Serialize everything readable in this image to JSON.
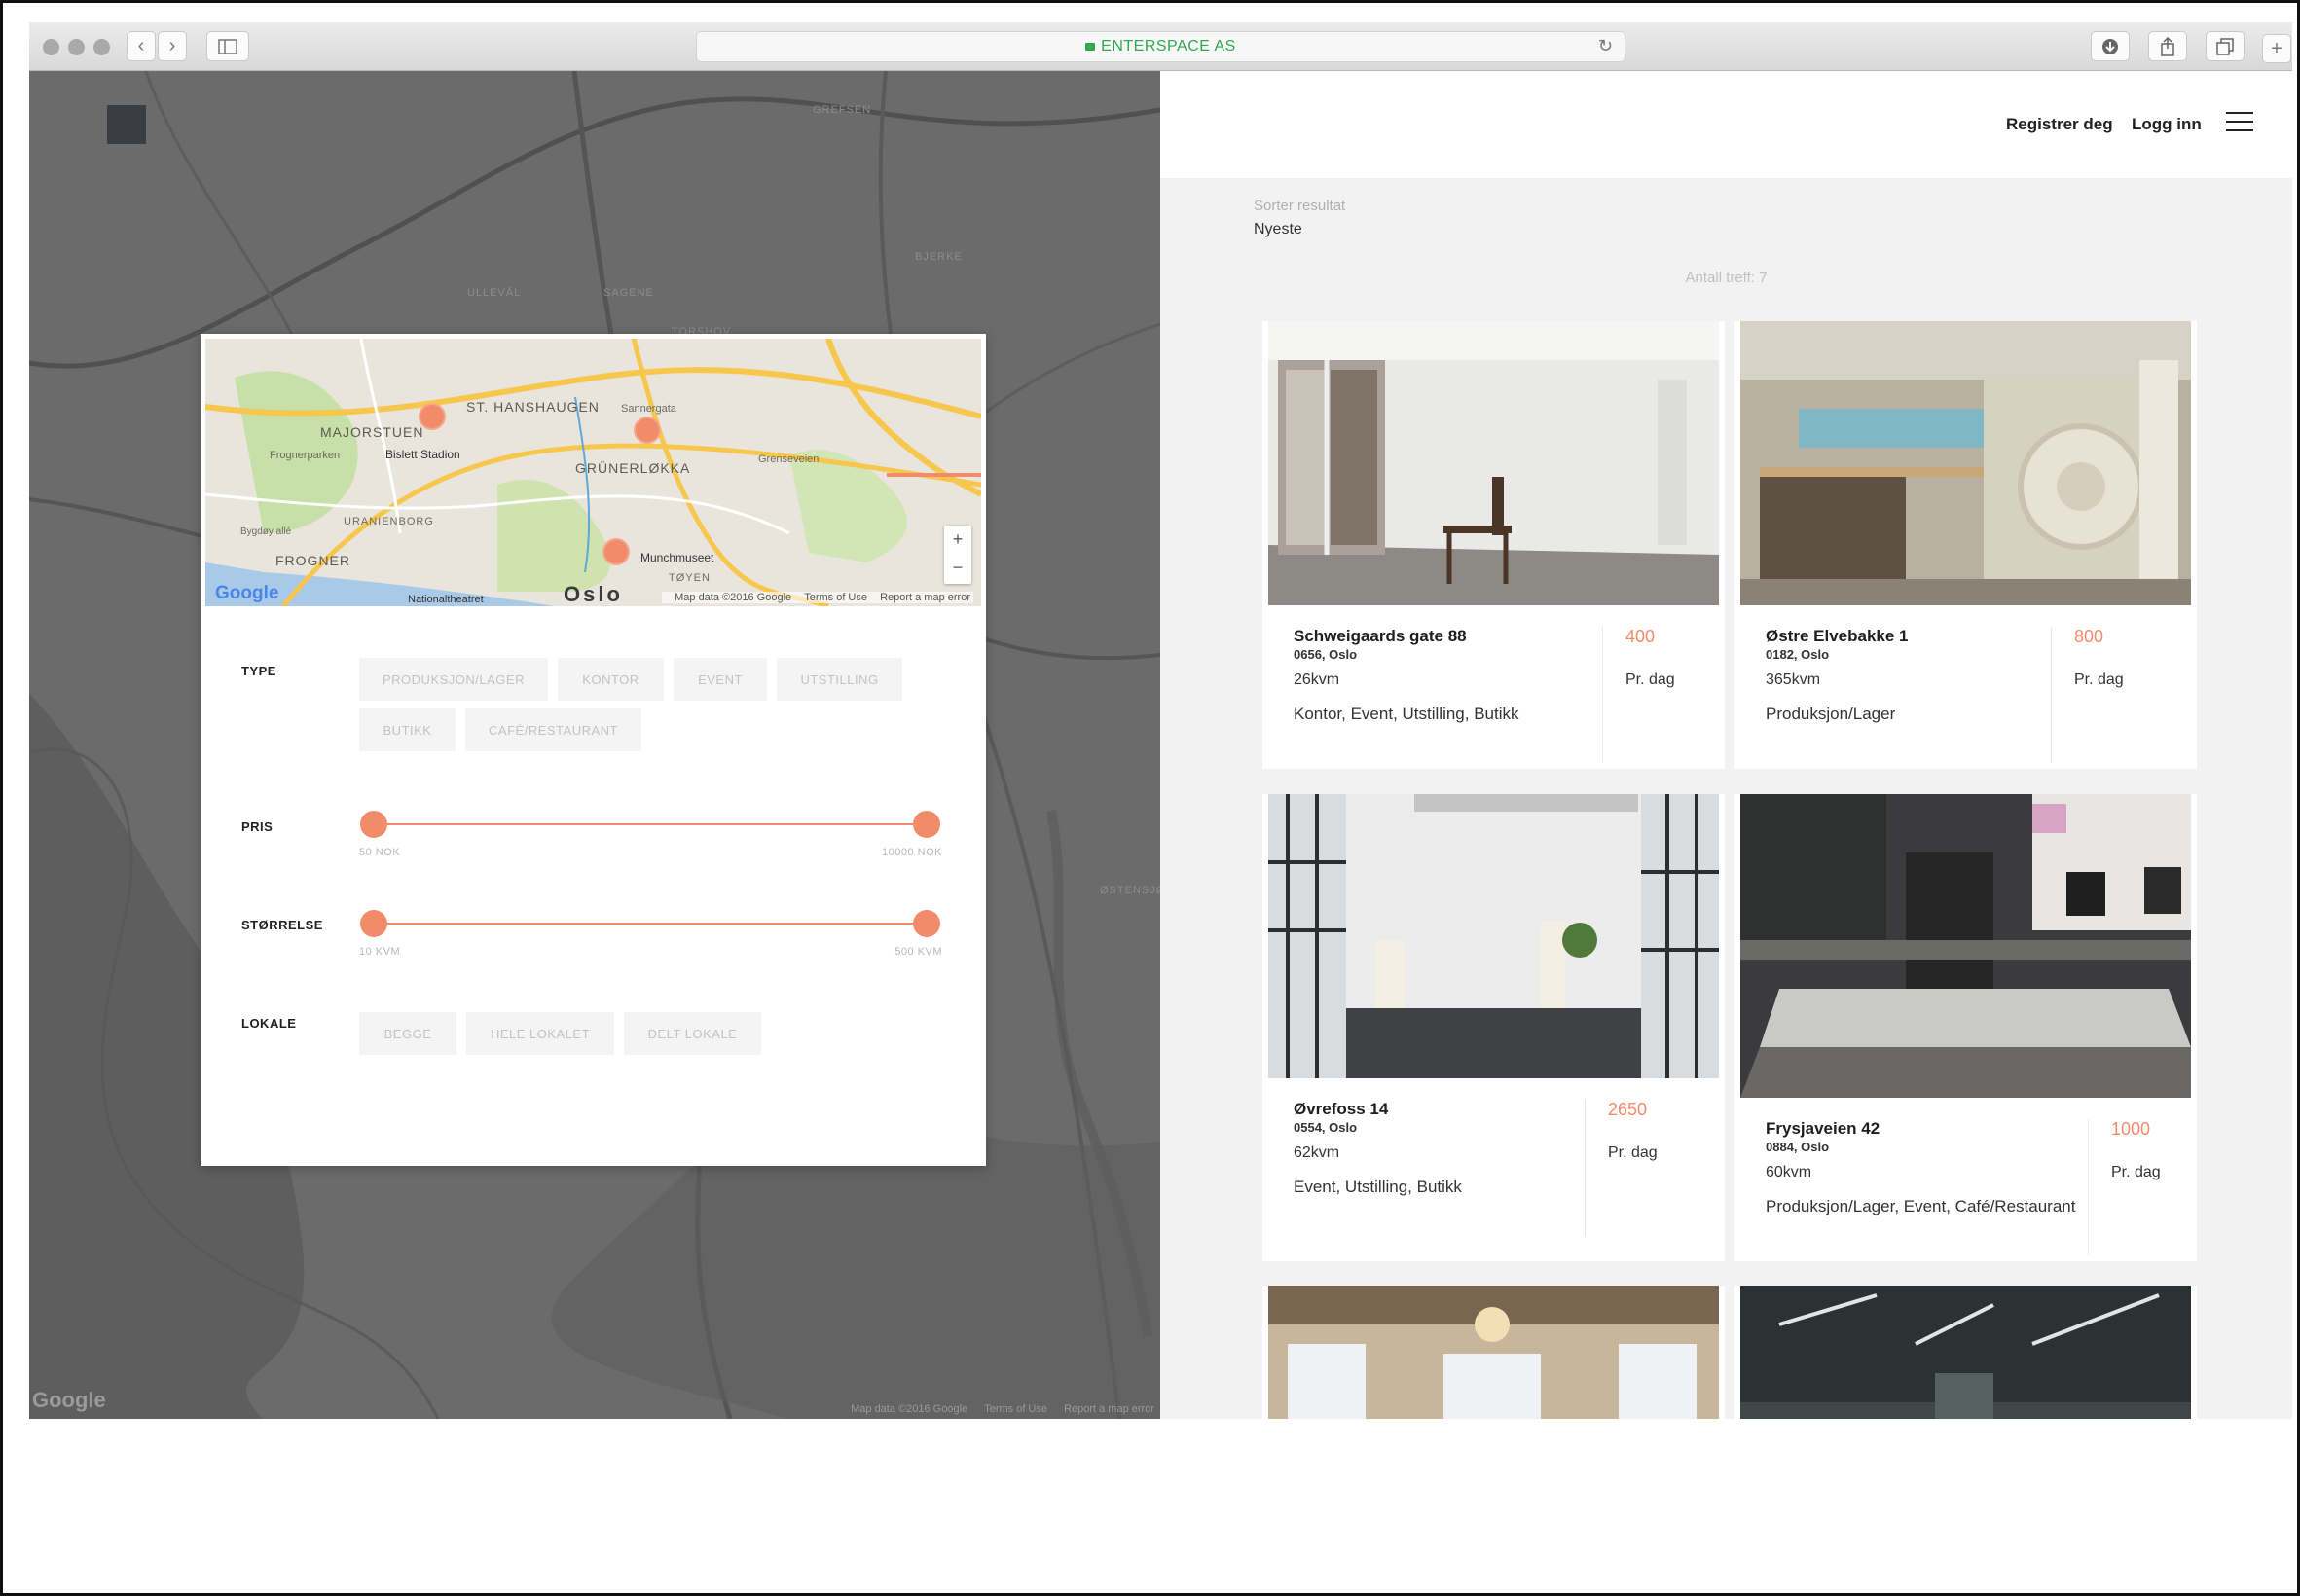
{
  "browser": {
    "url_label": "ENTERSPACE AS"
  },
  "map": {
    "labels": [
      "GREFSEN",
      "BJERKE",
      "ULLEVÅL",
      "SAGENE",
      "TORSHOV",
      "ØSTENSJØ"
    ],
    "attribution": "Map data ©2016 Google",
    "terms": "Terms of Use",
    "report": "Report a map error",
    "logo": "Google"
  },
  "filter": {
    "mini_map": {
      "labels": [
        "MAJORSTUEN",
        "ST. HANSHAUGEN",
        "GRÜNERLØKKA",
        "FROGNER",
        "URANIENBORG",
        "TØYEN"
      ],
      "small_labels": [
        "Frognerparken",
        "Bislett Stadion",
        "Sannergata",
        "Grenseveien",
        "Munchmuseet",
        "Nationaltheatret",
        "Bygdøy allé"
      ],
      "city": "Oslo",
      "attribution": "Map data ©2016 Google",
      "terms": "Terms of Use",
      "report": "Report a map error",
      "logo": "Google",
      "zoom_in": "+",
      "zoom_out": "−"
    },
    "type_label": "TYPE",
    "types": [
      "PRODUKSJON/LAGER",
      "KONTOR",
      "EVENT",
      "UTSTILLING",
      "BUTIKK",
      "CAFÉ/RESTAURANT"
    ],
    "price_label": "PRIS",
    "price_min": "50 NOK",
    "price_max": "10000 NOK",
    "size_label": "STØRRELSE",
    "size_min": "10 KVM",
    "size_max": "500 KVM",
    "venue_label": "LOKALE",
    "venues": [
      "BEGGE",
      "HELE LOKALET",
      "DELT LOKALE"
    ]
  },
  "header": {
    "register": "Registrer deg",
    "login": "Logg inn"
  },
  "sort": {
    "label": "Sorter resultat",
    "value": "Nyeste"
  },
  "results": {
    "count_text": "Antall treff: 7",
    "items": [
      {
        "title": "Schweigaards gate 88",
        "zip": "0656, Oslo",
        "size": "26kvm",
        "types": "Kontor, Event, Utstilling, Butikk",
        "price": "400",
        "per": "Pr. dag"
      },
      {
        "title": "Østre Elvebakke 1",
        "zip": "0182, Oslo",
        "size": "365kvm",
        "types": "Produksjon/Lager",
        "price": "800",
        "per": "Pr. dag"
      },
      {
        "title": "Øvrefoss 14",
        "zip": "0554, Oslo",
        "size": "62kvm",
        "types": "Event, Utstilling, Butikk",
        "price": "2650",
        "per": "Pr. dag"
      },
      {
        "title": "Frysjaveien 42",
        "zip": "0884, Oslo",
        "size": "60kvm",
        "types": "Produksjon/Lager, Event, Café/Restaurant",
        "price": "1000",
        "per": "Pr. dag"
      }
    ]
  },
  "colors": {
    "accent": "#f28b6a",
    "url_green": "#2fa84f",
    "map_gray": "#6b6b6b"
  }
}
